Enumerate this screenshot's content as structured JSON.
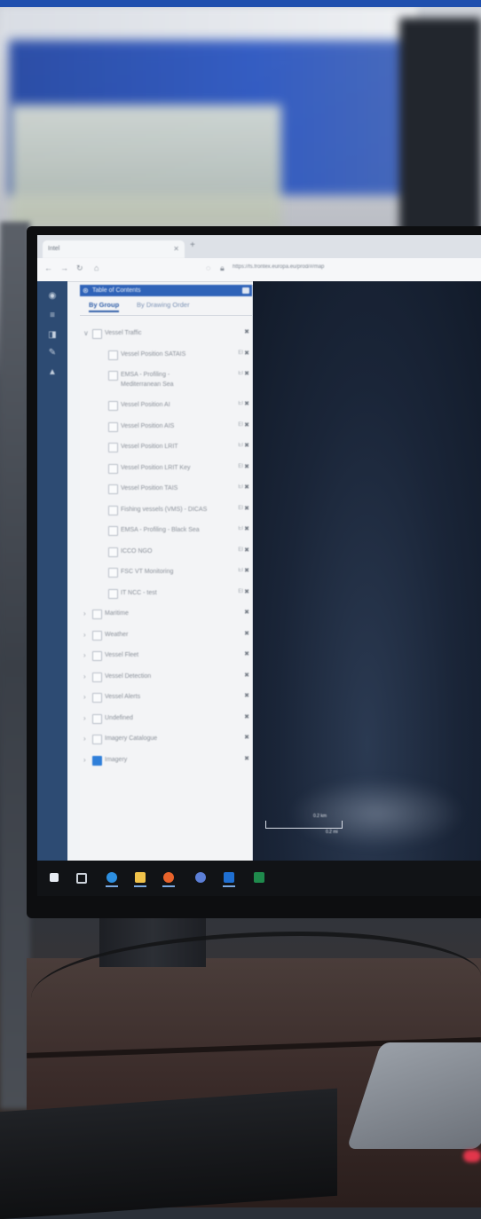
{
  "browser": {
    "tab_title": "Intel",
    "url": "https://fs.frontex.europa.eu/prod/#/map"
  },
  "toc": {
    "title": "Table of Contents",
    "tabs": [
      "By Group",
      "By Drawing Order"
    ],
    "rows": [
      {
        "label": "Vessel Traffic",
        "level": 0,
        "expanded": true,
        "checked": false,
        "tag": ""
      },
      {
        "label": "Vessel Position SATAIS",
        "level": 1,
        "checked": false,
        "tag": "EI"
      },
      {
        "label": "EMSA - Profiling -",
        "label2": "Mediterranean Sea",
        "level": 1,
        "checked": false,
        "tag": "EI"
      },
      {
        "label": "Vessel Position AI",
        "level": 1,
        "checked": false,
        "tag": "EI"
      },
      {
        "label": "Vessel Position AIS",
        "level": 1,
        "checked": false,
        "tag": "EI"
      },
      {
        "label": "Vessel Position LRIT",
        "level": 1,
        "checked": false,
        "tag": "EI"
      },
      {
        "label": "Vessel Position LRIT Key",
        "level": 1,
        "checked": false,
        "tag": "EI"
      },
      {
        "label": "Vessel Position TAIS",
        "level": 1,
        "checked": false,
        "tag": "EI"
      },
      {
        "label": "Fishing vessels (VMS) - DICAS",
        "level": 1,
        "checked": false,
        "tag": "EI"
      },
      {
        "label": "EMSA - Profiling - Black Sea",
        "level": 1,
        "checked": false,
        "tag": "EI"
      },
      {
        "label": "ICCO NGO",
        "level": 1,
        "checked": false,
        "tag": "EI"
      },
      {
        "label": "FSC VT Monitoring",
        "level": 1,
        "checked": false,
        "tag": "EI"
      },
      {
        "label": "IT NCC - test",
        "level": 1,
        "checked": false,
        "tag": "EI"
      },
      {
        "label": "Maritime",
        "level": 0,
        "expanded": false,
        "checked": false,
        "tag": ""
      },
      {
        "label": "Weather",
        "level": 0,
        "expanded": false,
        "checked": false,
        "tag": ""
      },
      {
        "label": "Vessel Fleet",
        "level": 0,
        "expanded": false,
        "checked": false,
        "tag": ""
      },
      {
        "label": "Vessel Detection",
        "level": 0,
        "expanded": false,
        "checked": false,
        "tag": ""
      },
      {
        "label": "Vessel Alerts",
        "level": 0,
        "expanded": false,
        "checked": false,
        "tag": ""
      },
      {
        "label": "Undefined",
        "level": 0,
        "expanded": false,
        "checked": false,
        "tag": ""
      },
      {
        "label": "Imagery Catalogue",
        "level": 0,
        "expanded": false,
        "checked": false,
        "tag": ""
      },
      {
        "label": "Imagery",
        "level": 0,
        "expanded": false,
        "checked": true,
        "tag": ""
      }
    ]
  },
  "map": {
    "scale_top": "0.2 km",
    "scale_bottom": "0.2 mi"
  },
  "colors": {
    "sidebar": "#2d4b73",
    "toc_header": "#2f63b8",
    "accent": "#2f5ea8",
    "checked": "#2f7fd9"
  },
  "icons": {
    "sidebar": [
      "layers-icon",
      "list-icon",
      "bookmark-icon",
      "pencil-icon",
      "person-icon"
    ],
    "taskbar": [
      "windows-start-icon",
      "task-view-icon",
      "edge-browser-icon",
      "file-explorer-icon",
      "firefox-icon",
      "chrome-icon",
      "outlook-icon",
      "excel-icon"
    ]
  }
}
